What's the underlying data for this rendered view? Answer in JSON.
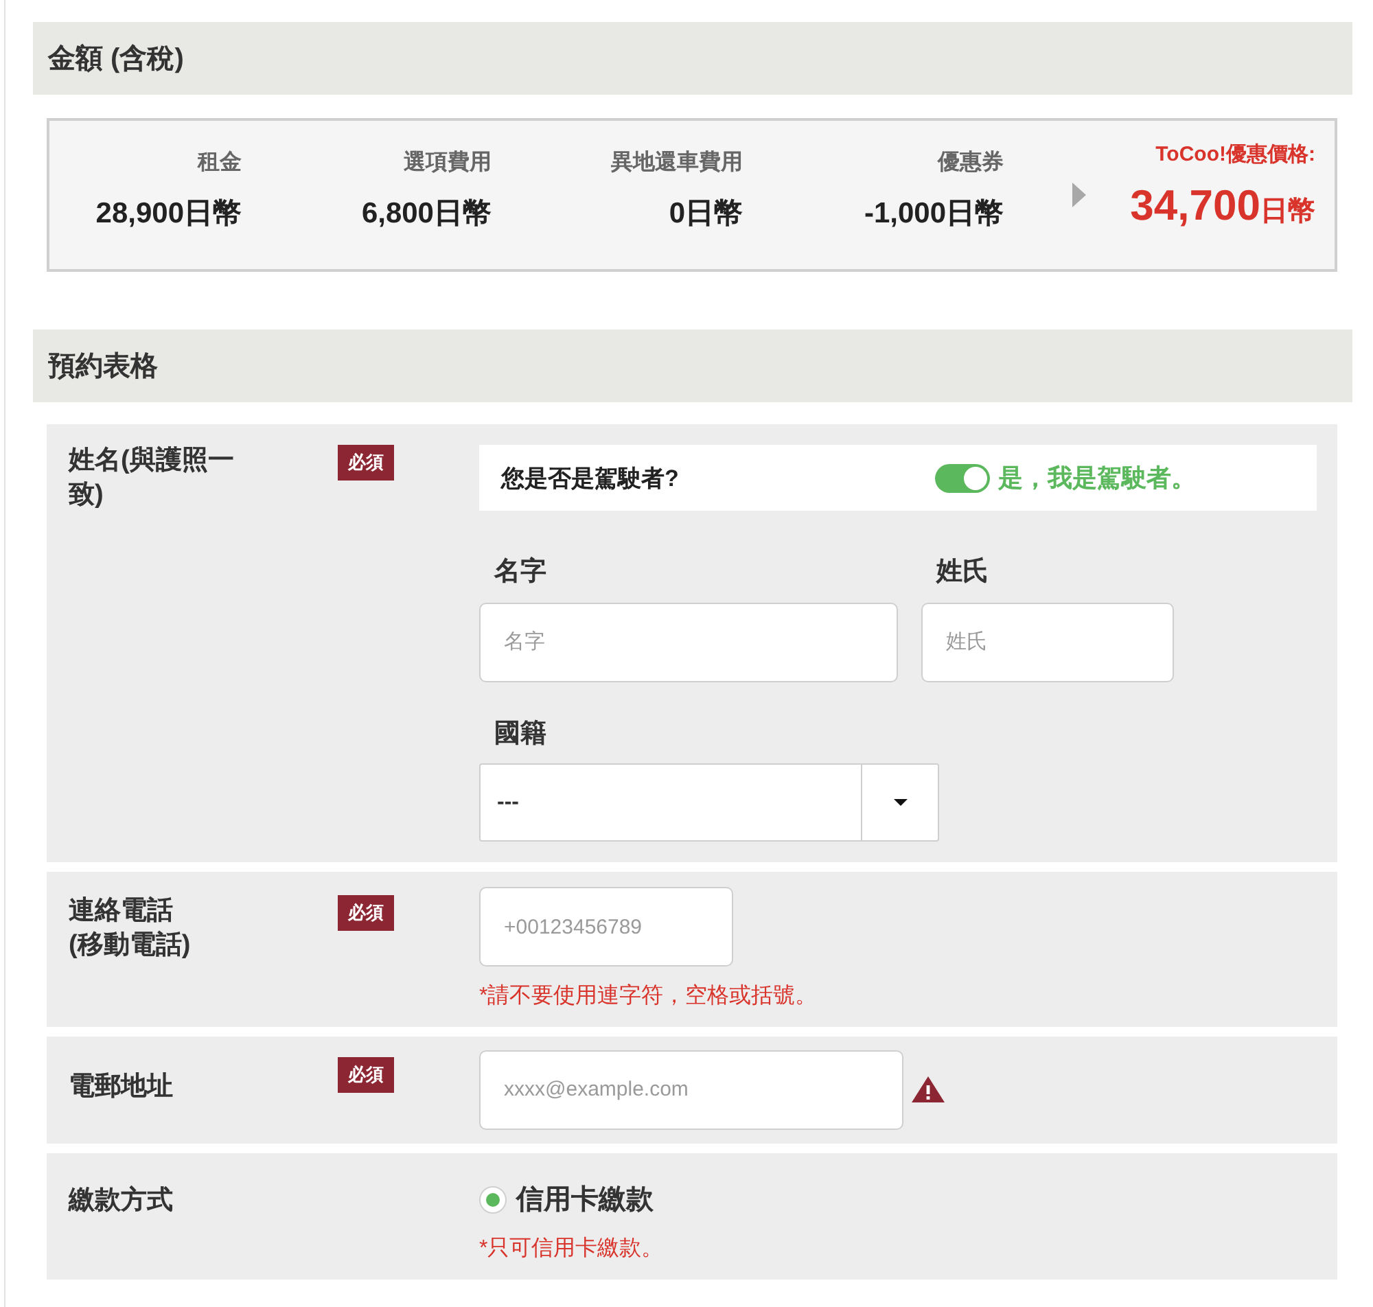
{
  "price_section": {
    "title": "金額 (含稅)",
    "items": [
      {
        "label": "租金",
        "amount": "28,900日幣"
      },
      {
        "label": "選項費用",
        "amount": "6,800日幣"
      },
      {
        "label": "異地還車費用",
        "amount": "0日幣"
      },
      {
        "label": "優惠券",
        "amount": "-1,000日幣"
      }
    ],
    "total": {
      "label": "ToCoo!優惠價格:",
      "amount": "34,700",
      "unit": "日幣"
    }
  },
  "form_section": {
    "title": "預約表格",
    "rows": [
      {
        "kind": "name",
        "label": "姓名(與護照一致)",
        "badge": "必須",
        "driver": {
          "question": "您是否是駕駛者?",
          "on": true,
          "answer": "是，我是駕駛者。"
        },
        "fields": [
          {
            "label": "名字",
            "placeholder": "名字"
          },
          {
            "label": "姓氏",
            "placeholder": "姓氏"
          }
        ],
        "select": {
          "label": "國籍",
          "value": "---"
        }
      },
      {
        "kind": "phone",
        "label": "連絡電話\n(移動電話)",
        "badge": "必須",
        "placeholder": "+00123456789",
        "warning": false,
        "note": "*請不要使用連字符，空格或括號。"
      },
      {
        "kind": "email",
        "label": "電郵地址",
        "badge": "必須",
        "placeholder": "xxxx@example.com",
        "warning": true
      },
      {
        "kind": "payment",
        "label": "繳款方式",
        "options": [
          {
            "label": "信用卡繳款",
            "selected": true
          }
        ],
        "note": "*只可信用卡繳款。"
      }
    ]
  }
}
